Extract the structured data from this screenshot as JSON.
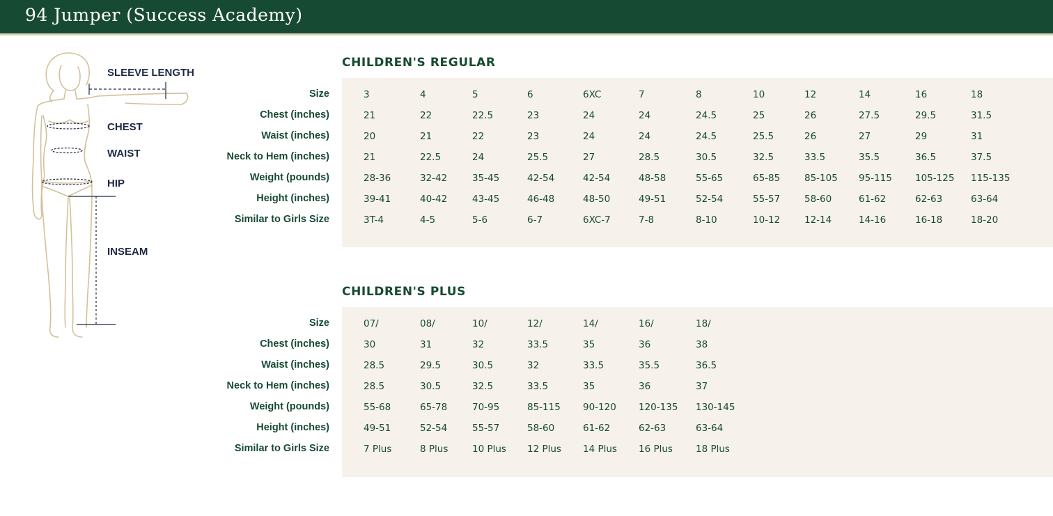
{
  "header": {
    "title": "94 Jumper (Success Academy)"
  },
  "figure": {
    "labels": [
      "SLEEVE LENGTH",
      "CHEST",
      "WAIST",
      "HIP",
      "INSEAM"
    ],
    "colors": {
      "outline": "#d4c19a",
      "guide": "#1e2a44"
    }
  },
  "colors": {
    "brand": "#174a32",
    "panel": "#f6f1ea"
  },
  "tables": [
    {
      "title": "CHILDREN'S REGULAR",
      "rows": [
        {
          "label": "Size",
          "values": [
            "3",
            "4",
            "5",
            "6",
            "6XC",
            "7",
            "8",
            "10",
            "12",
            "14",
            "16",
            "18"
          ]
        },
        {
          "label": "Chest (inches)",
          "values": [
            "21",
            "22",
            "22.5",
            "23",
            "24",
            "24",
            "24.5",
            "25",
            "26",
            "27.5",
            "29.5",
            "31.5"
          ]
        },
        {
          "label": "Waist (inches)",
          "values": [
            "20",
            "21",
            "22",
            "23",
            "24",
            "24",
            "24.5",
            "25.5",
            "26",
            "27",
            "29",
            "31"
          ]
        },
        {
          "label": "Neck to Hem (inches)",
          "values": [
            "21",
            "22.5",
            "24",
            "25.5",
            "27",
            "28.5",
            "30.5",
            "32.5",
            "33.5",
            "35.5",
            "36.5",
            "37.5"
          ]
        },
        {
          "label": "Weight (pounds)",
          "values": [
            "28-36",
            "32-42",
            "35-45",
            "42-54",
            "42-54",
            "48-58",
            "55-65",
            "65-85",
            "85-105",
            "95-115",
            "105-125",
            "115-135"
          ]
        },
        {
          "label": "Height (inches)",
          "values": [
            "39-41",
            "40-42",
            "43-45",
            "46-48",
            "48-50",
            "49-51",
            "52-54",
            "55-57",
            "58-60",
            "61-62",
            "62-63",
            "63-64"
          ]
        },
        {
          "label": "Similar to Girls Size",
          "values": [
            "3T-4",
            "4-5",
            "5-6",
            "6-7",
            "6XC-7",
            "7-8",
            "8-10",
            "10-12",
            "12-14",
            "14-16",
            "16-18",
            "18-20"
          ]
        }
      ]
    },
    {
      "title": "CHILDREN'S PLUS",
      "rows": [
        {
          "label": "Size",
          "values": [
            "07/",
            "08/",
            "10/",
            "12/",
            "14/",
            "16/",
            "18/"
          ]
        },
        {
          "label": "Chest (inches)",
          "values": [
            "30",
            "31",
            "32",
            "33.5",
            "35",
            "36",
            "38"
          ]
        },
        {
          "label": "Waist (inches)",
          "values": [
            "28.5",
            "29.5",
            "30.5",
            "32",
            "33.5",
            "35.5",
            "36.5"
          ]
        },
        {
          "label": "Neck to Hem (inches)",
          "values": [
            "28.5",
            "30.5",
            "32.5",
            "33.5",
            "35",
            "36",
            "37"
          ]
        },
        {
          "label": "Weight (pounds)",
          "values": [
            "55-68",
            "65-78",
            "70-95",
            "85-115",
            "90-120",
            "120-135",
            "130-145"
          ]
        },
        {
          "label": "Height (inches)",
          "values": [
            "49-51",
            "52-54",
            "55-57",
            "58-60",
            "61-62",
            "62-63",
            "63-64"
          ]
        },
        {
          "label": "Similar to Girls Size",
          "values": [
            "7 Plus",
            "8 Plus",
            "10 Plus",
            "12 Plus",
            "14 Plus",
            "16 Plus",
            "18 Plus"
          ]
        }
      ]
    }
  ]
}
